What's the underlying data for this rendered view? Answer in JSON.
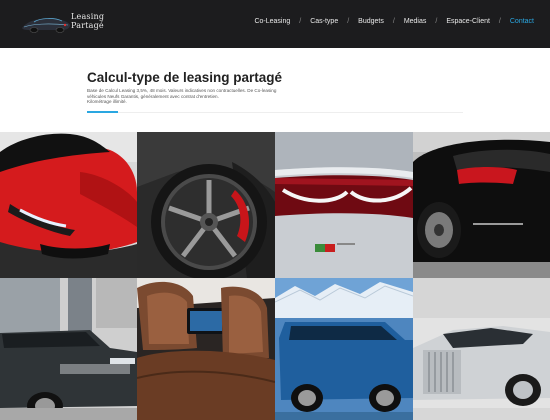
{
  "header": {
    "logo_line1": "Leasing",
    "logo_line2": "Partagé",
    "nav": [
      {
        "label": "Co-Leasing",
        "active": false
      },
      {
        "label": "Cas-type",
        "active": false
      },
      {
        "label": "Budgets",
        "active": false
      },
      {
        "label": "Medias",
        "active": false
      },
      {
        "label": "Espace-Client",
        "active": false
      },
      {
        "label": "Contact",
        "active": true
      }
    ],
    "separator": "/"
  },
  "content": {
    "title": "Calcul-type de leasing partagé",
    "desc_line1": "Base de Calcul Leasing 3,5%, 48 mois. Valeurs indicatives non contractuelles. De Co-leasing",
    "desc_line2": "véhicules Neufs Garantis, généralement avec contrat d'entretien.",
    "desc_line3": "Kilométrage illimité."
  },
  "tiles": [
    {
      "name": "red-sports-car-tile"
    },
    {
      "name": "sports-car-wheel-tile"
    },
    {
      "name": "jaguar-taillight-tile"
    },
    {
      "name": "black-coupe-rear-tile"
    },
    {
      "name": "range-rover-tile"
    },
    {
      "name": "luxury-interior-tile"
    },
    {
      "name": "blue-wagon-tile"
    },
    {
      "name": "rolls-royce-tile"
    }
  ],
  "colors": {
    "header_bg": "#1c1c1e",
    "accent": "#2aa7e1"
  }
}
